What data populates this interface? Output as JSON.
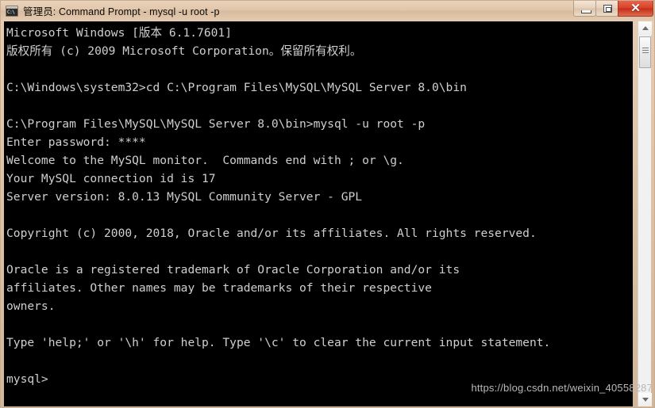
{
  "window": {
    "title": "管理员: Command Prompt - mysql  -u root -p",
    "icon": "cmd-console-icon",
    "icon_text": "C:\\",
    "frame_color": "#dcc0a4",
    "console_background": "#000000",
    "console_foreground": "#cfcfcf"
  },
  "titlebar_buttons": {
    "minimize_label": "─",
    "maximize_label": "❐",
    "close_label": "✕",
    "close_color": "#d8412a"
  },
  "console": {
    "lines": [
      "Microsoft Windows [版本 6.1.7601]",
      "版权所有 (c) 2009 Microsoft Corporation。保留所有权利。",
      "",
      "C:\\Windows\\system32>cd C:\\Program Files\\MySQL\\MySQL Server 8.0\\bin",
      "",
      "C:\\Program Files\\MySQL\\MySQL Server 8.0\\bin>mysql -u root -p",
      "Enter password: ****",
      "Welcome to the MySQL monitor.  Commands end with ; or \\g.",
      "Your MySQL connection id is 17",
      "Server version: 8.0.13 MySQL Community Server - GPL",
      "",
      "Copyright (c) 2000, 2018, Oracle and/or its affiliates. All rights reserved.",
      "",
      "Oracle is a registered trademark of Oracle Corporation and/or its",
      "affiliates. Other names may be trademarks of their respective",
      "owners.",
      "",
      "Type 'help;' or '\\h' for help. Type '\\c' to clear the current input statement.",
      "",
      "mysql>"
    ],
    "prompt": "mysql>",
    "os_version": "6.1.7601",
    "copyright_year": "2009",
    "mysql_connection_id": "17",
    "mysql_server_version": "8.0.13",
    "mysql_license": "GPL",
    "password_mask": "****",
    "working_directory": "C:\\Program Files\\MySQL\\MySQL Server 8.0\\bin",
    "command": "mysql -u root -p"
  },
  "scrollbar": {
    "up_arrow": "scroll-up-arrow",
    "down_arrow": "scroll-down-arrow",
    "thumb": "scroll-thumb"
  },
  "watermark": {
    "text": "https://blog.csdn.net/weixin_40558287"
  }
}
